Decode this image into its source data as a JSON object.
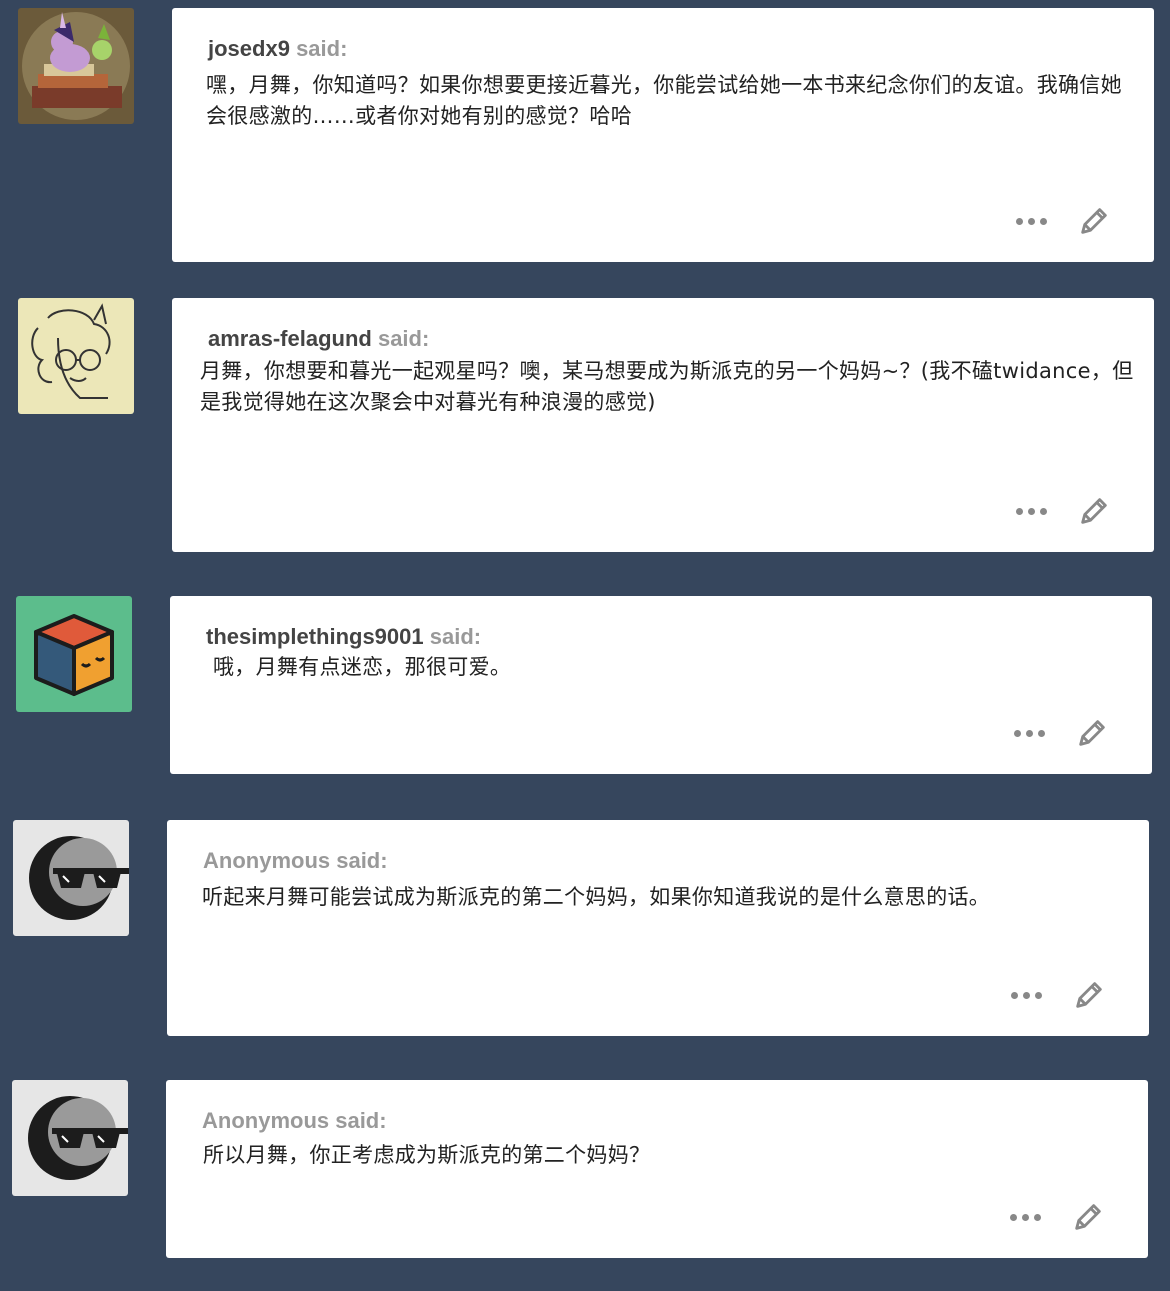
{
  "posts": [
    {
      "asker": "josedx9",
      "said": "said:",
      "anonymous": false,
      "avatar": "twilight-pony-books-avatar",
      "message": "嘿，月舞，你知道吗？如果你想要更接近暮光，你能尝试给她一本书来纪念你们的友谊。我确信她会很感激的……或者你对她有别的感觉？哈哈"
    },
    {
      "asker": "amras-felagund",
      "said": "said:",
      "anonymous": false,
      "avatar": "sketch-pony-glasses-avatar",
      "message": "月舞，你想要和暮光一起观星吗？噢，某马想要成为斯派克的另一个妈妈~？(我不磕twidance，但是我觉得她在这次聚会中对暮光有种浪漫的感觉)"
    },
    {
      "asker": "thesimplethings9001",
      "said": "said:",
      "anonymous": false,
      "avatar": "sleepy-cube-avatar",
      "message": " 哦，月舞有点迷恋，那很可爱。"
    },
    {
      "asker": "",
      "said": "Anonymous said:",
      "anonymous": true,
      "avatar": "anonymous-sunglasses-avatar",
      "message": "听起来月舞可能尝试成为斯派克的第二个妈妈，如果你知道我说的是什么意思的话。"
    },
    {
      "asker": "",
      "said": "Anonymous said:",
      "anonymous": true,
      "avatar": "anonymous-sunglasses-avatar",
      "message": "所以月舞，你正考虑成为斯派克的第二个妈妈？"
    }
  ],
  "colors": {
    "background": "#36465d",
    "card": "#ffffff",
    "asker_name": "#444444",
    "said_label": "#999999",
    "icon_gray": "#888888"
  },
  "icons": {
    "more": "more-options-icon",
    "edit": "pencil-edit-icon"
  }
}
